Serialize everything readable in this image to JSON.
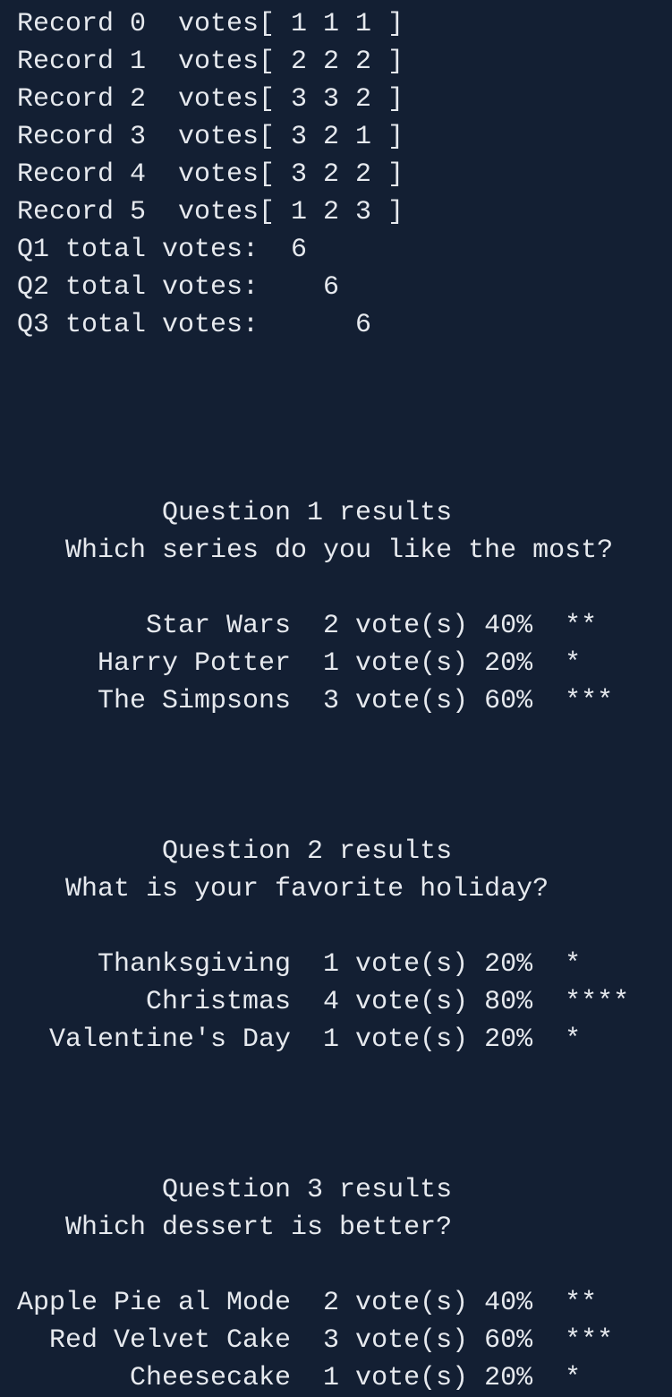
{
  "records": [
    {
      "label": "Record 0",
      "votes": "votes[ 1 1 1 ]"
    },
    {
      "label": "Record 1",
      "votes": "votes[ 2 2 2 ]"
    },
    {
      "label": "Record 2",
      "votes": "votes[ 3 3 2 ]"
    },
    {
      "label": "Record 3",
      "votes": "votes[ 3 2 1 ]"
    },
    {
      "label": "Record 4",
      "votes": "votes[ 3 2 2 ]"
    },
    {
      "label": "Record 5",
      "votes": "votes[ 1 2 3 ]"
    }
  ],
  "totals": [
    {
      "label": "Q1 total votes:",
      "value": "6"
    },
    {
      "label": "Q2 total votes:",
      "value": "6"
    },
    {
      "label": "Q3 total votes:",
      "value": "6"
    }
  ],
  "questions": [
    {
      "title": "Question 1 results",
      "prompt": "Which series do you like the most?",
      "options": [
        {
          "name": "Star Wars",
          "votes": "2 vote(s)",
          "percent": "40%",
          "stars": "**"
        },
        {
          "name": "Harry Potter",
          "votes": "1 vote(s)",
          "percent": "20%",
          "stars": "*"
        },
        {
          "name": "The Simpsons",
          "votes": "3 vote(s)",
          "percent": "60%",
          "stars": "***"
        }
      ]
    },
    {
      "title": "Question 2 results",
      "prompt": "What is your favorite holiday?",
      "options": [
        {
          "name": "Thanksgiving",
          "votes": "1 vote(s)",
          "percent": "20%",
          "stars": "*"
        },
        {
          "name": "Christmas",
          "votes": "4 vote(s)",
          "percent": "80%",
          "stars": "****"
        },
        {
          "name": "Valentine's Day",
          "votes": "1 vote(s)",
          "percent": "20%",
          "stars": "*"
        }
      ]
    },
    {
      "title": "Question 3 results",
      "prompt": "Which dessert is better?",
      "options": [
        {
          "name": "Apple Pie al Mode",
          "votes": "2 vote(s)",
          "percent": "40%",
          "stars": "**"
        },
        {
          "name": "Red Velvet Cake",
          "votes": "3 vote(s)",
          "percent": "60%",
          "stars": "***"
        },
        {
          "name": "Cheesecake",
          "votes": "1 vote(s)",
          "percent": "20%",
          "stars": "*"
        }
      ]
    }
  ],
  "colors": {
    "background": "#131f33",
    "text": "#e6e9ee"
  }
}
